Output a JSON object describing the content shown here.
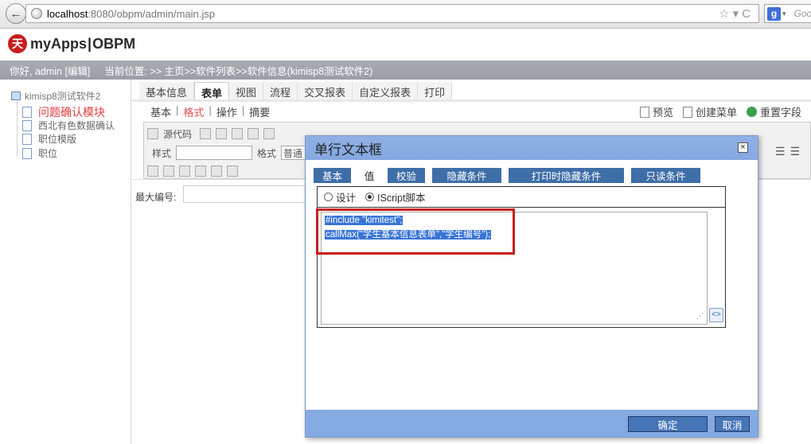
{
  "browser": {
    "url_host": "localhost",
    "url_rest": ":8080/obpm/admin/main.jsp",
    "search_placeholder": "Goo"
  },
  "app": {
    "logo_text_left": "myApps",
    "logo_text_right": "OBPM",
    "greeting": "你好, admin [编辑]",
    "location": "当前位置: >> 主页>>软件列表>>软件信息(kimisp8测试软件2)"
  },
  "tree": {
    "root": "kimisp8测试软件2",
    "items": [
      "问题确认模块",
      "西北有色数据确认",
      "职位模版",
      "职位"
    ]
  },
  "tabs": [
    "基本信息",
    "表单",
    "视图",
    "流程",
    "交叉报表",
    "自定义报表",
    "打印"
  ],
  "subtabs": [
    "基本",
    "格式",
    "操作",
    "摘要"
  ],
  "actions": {
    "preview": "预览",
    "create_menu": "创建菜单",
    "reset": "重置字段"
  },
  "toolbar": {
    "source": "源代码",
    "style": "样式",
    "format": "格式",
    "format_val": "普通"
  },
  "form": {
    "max_number_label": "最大编号:"
  },
  "dialog": {
    "title": "单行文本框",
    "tabs": [
      "基本",
      "值",
      "校验",
      "隐藏条件",
      "打印时隐藏条件",
      "只读条件"
    ],
    "radio_design": "设计",
    "radio_script": "IScript脚本",
    "code_line1": "#include \"kimitest\";",
    "code_line2": "callMax(\"学生基本信息表单\",\"学生编号\");",
    "ok": "确定",
    "cancel": "取消"
  }
}
